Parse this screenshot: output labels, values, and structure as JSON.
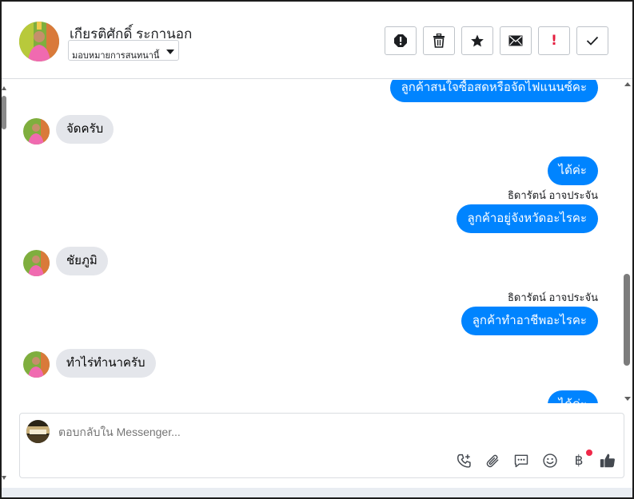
{
  "contact": {
    "name": "เกียรติศักดิ์ ระกานอก"
  },
  "assign": {
    "label": "มอบหมายการสนทนานี้"
  },
  "toolbar": {
    "spam": "spam-icon",
    "delete": "trash-icon",
    "star": "star-icon",
    "unread": "envelope-icon",
    "follow_up": "!",
    "done": "check-icon"
  },
  "messages": [
    {
      "dir": "out",
      "text": "ลูกค้าสนใจซื้อสดหรือจัดไฟแนนซ์คะ"
    },
    {
      "dir": "in",
      "text": "จัดครับ"
    },
    {
      "dir": "out",
      "text": "ได้ค่ะ"
    },
    {
      "dir": "out",
      "sender": "ธิดารัตน์ อาจประจัน",
      "text": "ลูกค้าอยู่จังหวัดอะไรคะ"
    },
    {
      "dir": "in",
      "text": "ชัยภูมิ"
    },
    {
      "dir": "out",
      "sender": "ธิดารัตน์ อาจประจัน",
      "text": "ลูกค้าทำอาชีพอะไรคะ"
    },
    {
      "dir": "in",
      "text": "ทำไร่ทำนาครับ"
    },
    {
      "dir": "out",
      "text": "ได้ค่ะ"
    }
  ],
  "composer": {
    "placeholder": "ตอบกลับใน Messenger...",
    "icons": [
      "phone-add-icon",
      "attachment-icon",
      "saved-reply-icon",
      "emoji-icon",
      "baht-payment-icon",
      "like-icon"
    ],
    "baht_symbol": "฿"
  },
  "colors": {
    "outgoing": "#0084ff",
    "incoming": "#e4e6eb",
    "badge": "#f02849",
    "follow_up": "#e41e3f"
  }
}
